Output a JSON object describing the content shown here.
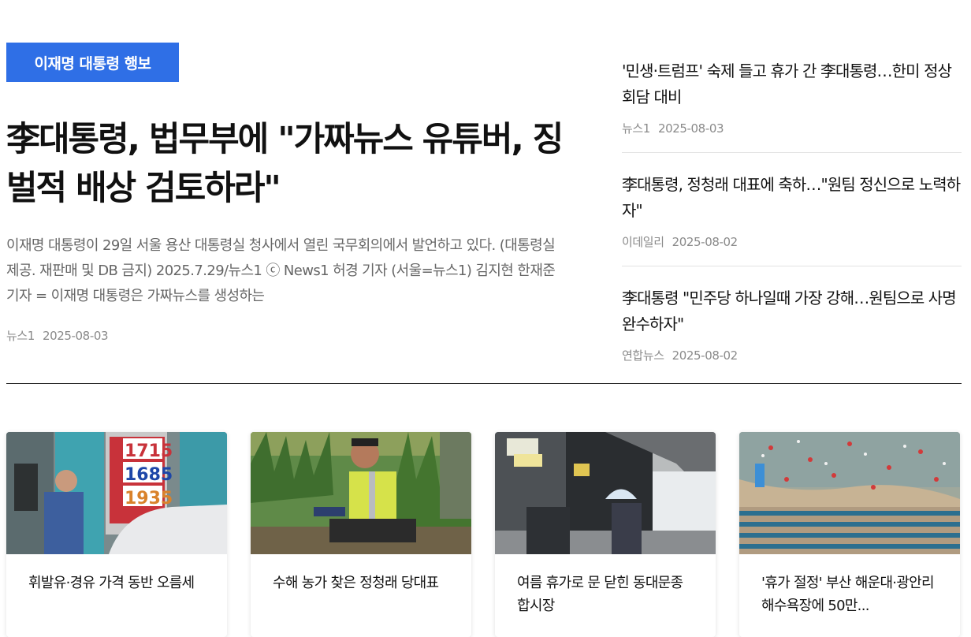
{
  "lead": {
    "tag": "이재명 대통령 행보",
    "headline": "李대통령, 법무부에 \"가짜뉴스 유튜버, 징벌적 배상 검토하라\"",
    "summary": "이재명 대통령이 29일 서울 용산 대통령실 청사에서 열린 국무회의에서 발언하고 있다. (대통령실 제공. 재판매 및 DB 금지) 2025.7.29/뉴스1 ⓒ News1 허경 기자 (서울=뉴스1) 김지현 한재준 기자 = 이재명 대통령은 가짜뉴스를 생성하는",
    "source": "뉴스1",
    "date": "2025-08-03"
  },
  "side_news": [
    {
      "title": "'민생·트럼프' 숙제 들고 휴가 간 李대통령…한미 정상회담 대비",
      "source": "뉴스1",
      "date": "2025-08-03"
    },
    {
      "title": "李대통령, 정청래 대표에 축하…\"원팀 정신으로 노력하자\"",
      "source": "이데일리",
      "date": "2025-08-02"
    },
    {
      "title": "李대통령 \"민주당 하나일때 가장 강해…원팀으로 사명 완수하자\"",
      "source": "연합뉴스",
      "date": "2025-08-02"
    }
  ],
  "cards": [
    {
      "title": "휘발유·경유 가격 동반 오름세",
      "price_board": [
        "1715",
        "1685",
        "1935"
      ]
    },
    {
      "title": "수해 농가 찾은 정청래 당대표"
    },
    {
      "title": "여름 휴가로 문 닫힌 동대문종합시장"
    },
    {
      "title": "'휴가 절정' 부산 해운대·광안리 해수욕장에 50만..."
    }
  ],
  "colors": {
    "tag_bg": "#2f6fe6",
    "divider": "#222222",
    "meta": "#8a8a8a"
  }
}
